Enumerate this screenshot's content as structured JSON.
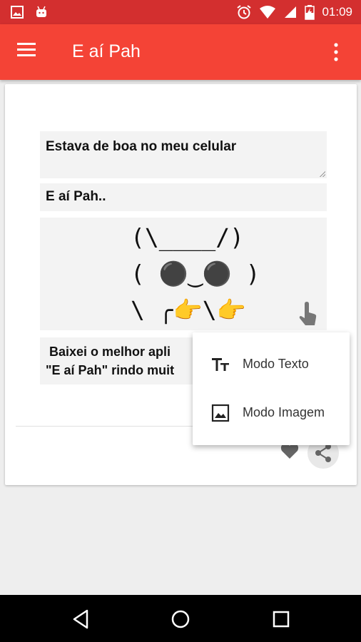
{
  "status_bar": {
    "time": "01:09",
    "left_icons": [
      "image-icon",
      "android-icon"
    ],
    "right_icons": [
      "alarm-icon",
      "wifi-icon",
      "signal-icon",
      "battery-charging-icon"
    ]
  },
  "app_bar": {
    "title": "E aí Pah",
    "color": "#f44336"
  },
  "card": {
    "field1": "Estava de boa no meu celular",
    "field2": "E aí Pah..",
    "ascii_art": "(\\____/)\n( ⚫‿⚫ )\n\\ ╭👉\\👉",
    "field3_line1": "Baixei o melhor apli",
    "field3_line2": "\"E aí Pah\" rindo muit"
  },
  "popup_menu": {
    "items": [
      {
        "label": "Modo Texto",
        "icon": "text-format-icon"
      },
      {
        "label": "Modo Imagem",
        "icon": "image-icon"
      }
    ]
  },
  "nav_bar": {
    "buttons": [
      "back-icon",
      "home-icon",
      "recents-icon"
    ]
  }
}
